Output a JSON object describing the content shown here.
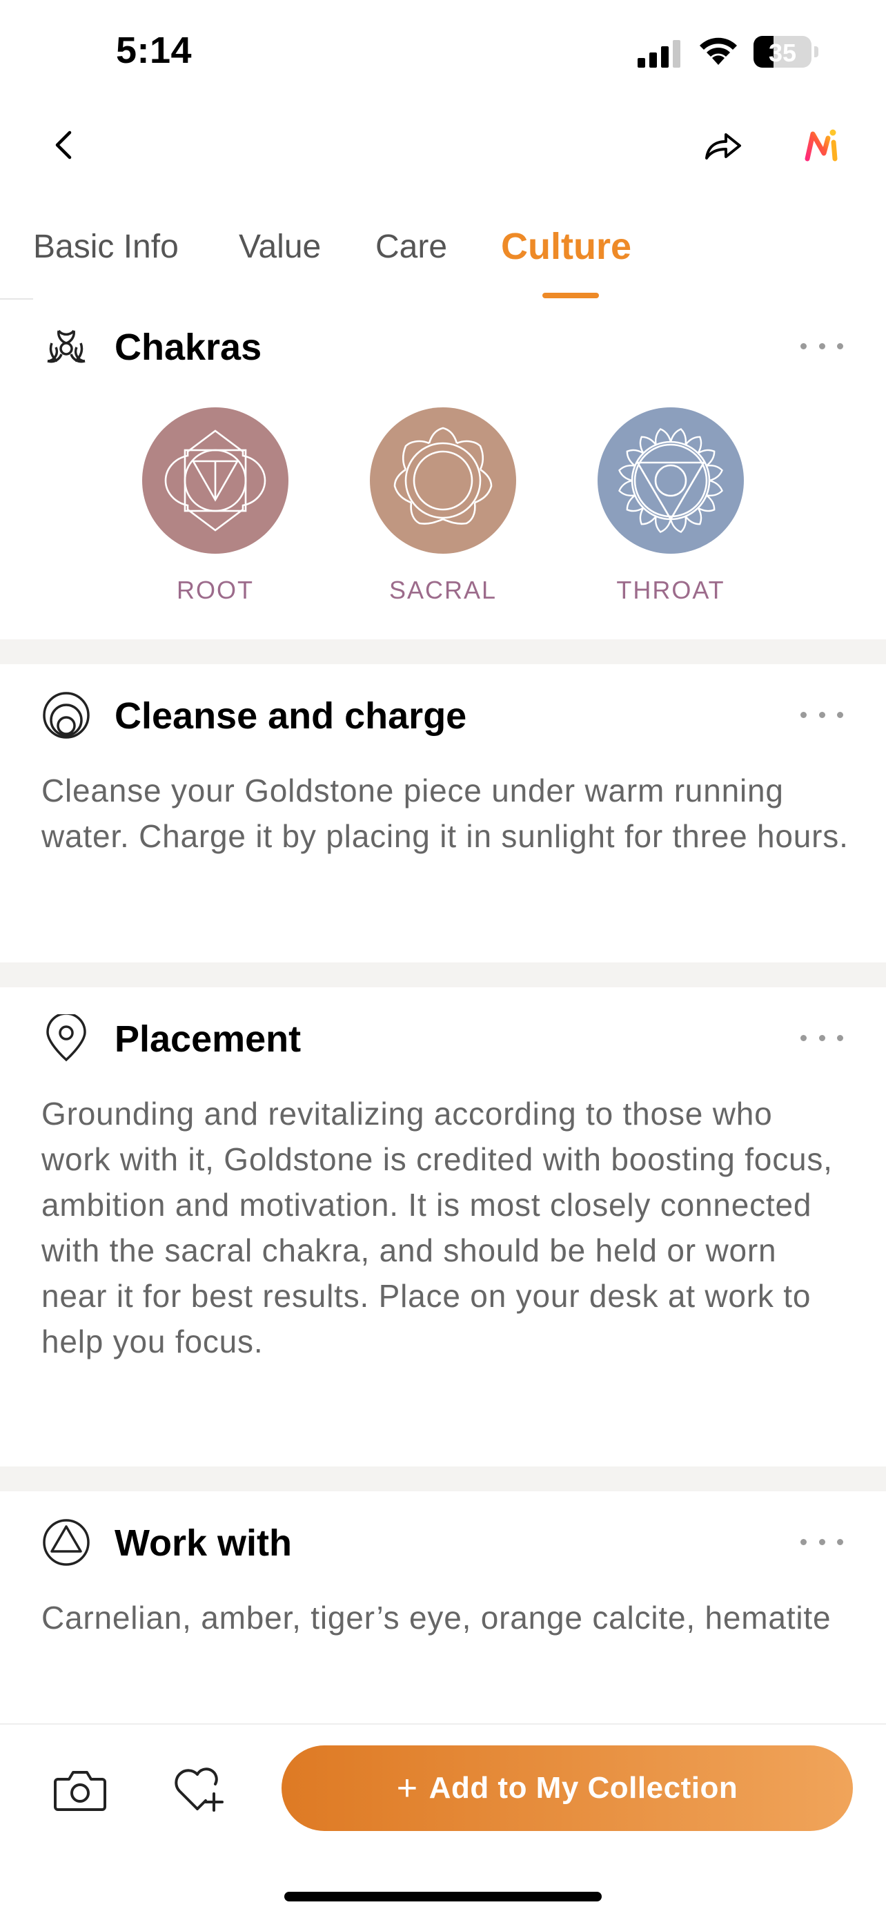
{
  "status_bar": {
    "time": "5:14",
    "battery_level": "35",
    "battery_fraction": 0.35
  },
  "nav": {
    "back_icon": "chevron-left-icon",
    "share_icon": "share-icon",
    "logo_icon": "app-logo-icon"
  },
  "tabs": [
    {
      "label": "Basic Info",
      "active": false
    },
    {
      "label": "Value",
      "active": false
    },
    {
      "label": "Care",
      "active": false
    },
    {
      "label": "Culture",
      "active": true
    }
  ],
  "colors": {
    "accent": "#ee8a27",
    "root": "#b28585",
    "sacral": "#c09781",
    "throat": "#8c9fbd",
    "chakra_label": "#9c6b8b"
  },
  "sections": {
    "chakras": {
      "title": "Chakras",
      "icon": "biohazard-icon",
      "items": [
        {
          "label": "ROOT",
          "icon": "root-chakra-icon"
        },
        {
          "label": "SACRAL",
          "icon": "sacral-chakra-icon"
        },
        {
          "label": "THROAT",
          "icon": "throat-chakra-icon"
        }
      ]
    },
    "cleanse": {
      "title": "Cleanse and charge",
      "icon": "cleanse-icon",
      "body": "Cleanse your Goldstone piece under warm running water. Charge it by placing it in sunlight for three hours."
    },
    "placement": {
      "title": "Placement",
      "icon": "location-pin-icon",
      "body": "Grounding and revitalizing according to those who work with it, Goldstone is credited with boosting focus, ambition and motivation. It is most closely connected with the sacral chakra, and should be held or worn near it for best results. Place on your desk at work to help you focus."
    },
    "work_with": {
      "title": "Work with",
      "icon": "triangle-circle-icon",
      "body": "Carnelian, amber, tiger’s eye, orange calcite, hematite"
    }
  },
  "bottom_bar": {
    "camera_icon": "camera-icon",
    "favorite_icon": "heart-plus-icon",
    "add_label": "Add to My Collection",
    "add_plus": "+"
  }
}
